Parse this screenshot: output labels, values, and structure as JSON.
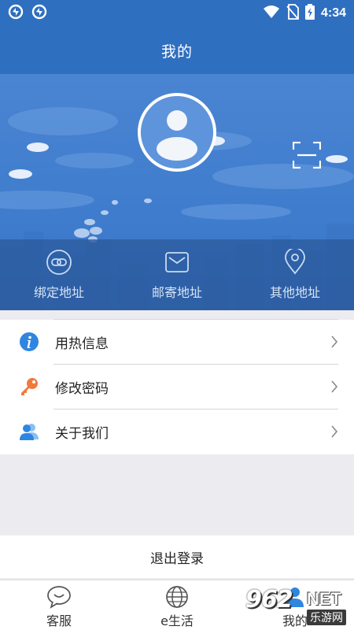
{
  "status_bar": {
    "time": "4:34",
    "icons": [
      "sync-icon",
      "sync-icon",
      "wifi-icon",
      "no-sim-icon",
      "battery-charging-icon"
    ]
  },
  "header": {
    "title": "我的"
  },
  "profile": {
    "avatar_icon": "user-avatar-icon",
    "scan_icon": "scan-icon"
  },
  "address_tabs": [
    {
      "label": "绑定地址",
      "icon": "link-icon"
    },
    {
      "label": "邮寄地址",
      "icon": "mail-icon"
    },
    {
      "label": "其他地址",
      "icon": "location-pin-icon"
    }
  ],
  "menu": {
    "items": [
      {
        "label": "用热信息",
        "icon": "info-icon",
        "icon_color": "#2f86e0"
      },
      {
        "label": "修改密码",
        "icon": "key-icon",
        "icon_color": "#f07a3c"
      },
      {
        "label": "关于我们",
        "icon": "users-icon",
        "icon_color": "#2f86e0"
      }
    ]
  },
  "logout": {
    "label": "退出登录"
  },
  "tab_bar": {
    "tabs": [
      {
        "label": "客服",
        "icon": "chat-icon"
      },
      {
        "label": "e生活",
        "icon": "globe-icon"
      },
      {
        "label": "我的",
        "icon": "user-icon"
      }
    ]
  },
  "watermark": {
    "logo": "962",
    "net": "NET",
    "sub": "乐游网"
  },
  "colors": {
    "primary": "#2f6fc0",
    "hero": "#4a85d2",
    "background": "#ececf0"
  }
}
